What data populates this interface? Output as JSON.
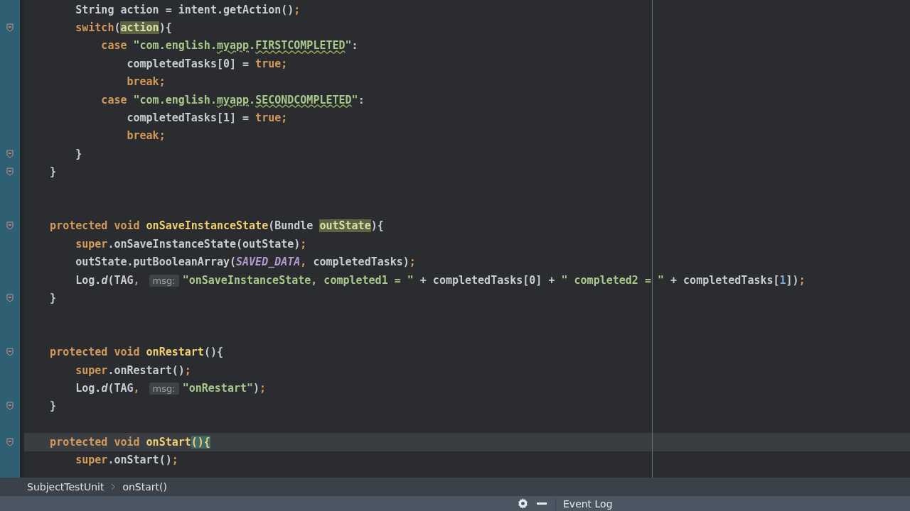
{
  "editor": {
    "lines": [
      {
        "fold": false,
        "current": false,
        "tokens": [
          {
            "kind": "plain",
            "text": "        String action = intent.getAction()"
          },
          {
            "kind": "kw",
            "text": ";"
          }
        ]
      },
      {
        "fold": true,
        "current": false,
        "tokens": [
          {
            "kind": "kw",
            "text": "        switch"
          },
          {
            "kind": "plain",
            "text": "("
          },
          {
            "kind": "match",
            "text": "action"
          },
          {
            "kind": "plain",
            "text": "){"
          }
        ]
      },
      {
        "fold": false,
        "current": false,
        "tokens": [
          {
            "kind": "kw",
            "text": "            case "
          },
          {
            "kind": "str",
            "text": "\"com.english."
          },
          {
            "kind": "typo",
            "text": "myapp"
          },
          {
            "kind": "str",
            "text": "."
          },
          {
            "kind": "typo",
            "text": "FIRSTCOMPLETED"
          },
          {
            "kind": "str",
            "text": "\""
          },
          {
            "kind": "plain",
            "text": ":"
          }
        ]
      },
      {
        "fold": false,
        "current": false,
        "tokens": [
          {
            "kind": "plain",
            "text": "                completedTasks[0] = "
          },
          {
            "kind": "kw",
            "text": "true;"
          }
        ]
      },
      {
        "fold": false,
        "current": false,
        "tokens": [
          {
            "kind": "kw",
            "text": "                break;"
          }
        ]
      },
      {
        "fold": false,
        "current": false,
        "tokens": [
          {
            "kind": "kw",
            "text": "            case "
          },
          {
            "kind": "str",
            "text": "\"com.english."
          },
          {
            "kind": "typo",
            "text": "myapp"
          },
          {
            "kind": "str",
            "text": "."
          },
          {
            "kind": "typo",
            "text": "SECONDCOMPLETED"
          },
          {
            "kind": "str",
            "text": "\""
          },
          {
            "kind": "plain",
            "text": ":"
          }
        ]
      },
      {
        "fold": false,
        "current": false,
        "tokens": [
          {
            "kind": "plain",
            "text": "                completedTasks[1] = "
          },
          {
            "kind": "kw",
            "text": "true;"
          }
        ]
      },
      {
        "fold": false,
        "current": false,
        "tokens": [
          {
            "kind": "kw",
            "text": "                break;"
          }
        ]
      },
      {
        "fold": true,
        "current": false,
        "tokens": [
          {
            "kind": "plain",
            "text": "        }"
          }
        ]
      },
      {
        "fold": true,
        "current": false,
        "tokens": [
          {
            "kind": "plain",
            "text": "    }"
          }
        ]
      },
      {
        "fold": false,
        "current": false
      },
      {
        "fold": false,
        "current": false
      },
      {
        "fold": true,
        "current": false,
        "tokens": [
          {
            "kind": "kw",
            "text": "    protected void "
          },
          {
            "kind": "fn",
            "text": "onSaveInstanceState"
          },
          {
            "kind": "plain",
            "text": "(Bundle "
          },
          {
            "kind": "match",
            "text": "outState"
          },
          {
            "kind": "plain",
            "text": "){"
          }
        ]
      },
      {
        "fold": false,
        "current": false,
        "tokens": [
          {
            "kind": "kw",
            "text": "        super"
          },
          {
            "kind": "plain",
            "text": ".onSaveInstanceState(outState)"
          },
          {
            "kind": "kw",
            "text": ";"
          }
        ]
      },
      {
        "fold": false,
        "current": false,
        "tokens": [
          {
            "kind": "plain",
            "text": "        outState.putBooleanArray("
          },
          {
            "kind": "const",
            "text": "SAVED_DATA"
          },
          {
            "kind": "kw",
            "text": ","
          },
          {
            "kind": "plain",
            "text": " completedTasks)"
          },
          {
            "kind": "kw",
            "text": ";"
          }
        ]
      },
      {
        "fold": false,
        "current": false,
        "tokens": [
          {
            "kind": "plain",
            "text": "        Log."
          },
          {
            "kind": "italic",
            "text": "d"
          },
          {
            "kind": "plain",
            "text": "(TAG"
          },
          {
            "kind": "kw",
            "text": ", "
          },
          {
            "kind": "hint",
            "text": "msg:"
          },
          {
            "kind": "str",
            "text": "\"onSaveInstanceState, completed1 = \""
          },
          {
            "kind": "plain",
            "text": " + completedTasks[0] + "
          },
          {
            "kind": "str",
            "text": "\" completed2 = \""
          },
          {
            "kind": "plain",
            "text": " + completedTasks["
          },
          {
            "kind": "num",
            "text": "1"
          },
          {
            "kind": "plain",
            "text": "])"
          },
          {
            "kind": "kw",
            "text": ";"
          }
        ]
      },
      {
        "fold": true,
        "current": false,
        "tokens": [
          {
            "kind": "plain",
            "text": "    }"
          }
        ]
      },
      {
        "fold": false,
        "current": false
      },
      {
        "fold": false,
        "current": false
      },
      {
        "fold": true,
        "current": false,
        "tokens": [
          {
            "kind": "kw",
            "text": "    protected void "
          },
          {
            "kind": "fn",
            "text": "onRestart"
          },
          {
            "kind": "plain",
            "text": "(){"
          }
        ]
      },
      {
        "fold": false,
        "current": false,
        "tokens": [
          {
            "kind": "kw",
            "text": "        super"
          },
          {
            "kind": "plain",
            "text": ".onRestart()"
          },
          {
            "kind": "kw",
            "text": ";"
          }
        ]
      },
      {
        "fold": false,
        "current": false,
        "tokens": [
          {
            "kind": "plain",
            "text": "        Log."
          },
          {
            "kind": "italic",
            "text": "d"
          },
          {
            "kind": "plain",
            "text": "(TAG"
          },
          {
            "kind": "kw",
            "text": ", "
          },
          {
            "kind": "hint",
            "text": "msg:"
          },
          {
            "kind": "str",
            "text": "\"onRestart\""
          },
          {
            "kind": "plain",
            "text": ")"
          },
          {
            "kind": "kw",
            "text": ";"
          }
        ]
      },
      {
        "fold": true,
        "current": false,
        "tokens": [
          {
            "kind": "plain",
            "text": "    }"
          }
        ]
      },
      {
        "fold": false,
        "current": false
      },
      {
        "fold": true,
        "current": true,
        "tokens": [
          {
            "kind": "kw",
            "text": "    protected void "
          },
          {
            "kind": "fn",
            "text": "onStart"
          },
          {
            "kind": "brace",
            "text": "(){"
          }
        ]
      },
      {
        "fold": false,
        "current": false,
        "tokens": [
          {
            "kind": "kw",
            "text": "        super"
          },
          {
            "kind": "plain",
            "text": ".onStart()"
          },
          {
            "kind": "kw",
            "text": ";"
          }
        ]
      }
    ]
  },
  "breadcrumb": [
    "SubjectTestUnit",
    "onStart()"
  ],
  "status_bar": {
    "event_log": "Event Log"
  }
}
